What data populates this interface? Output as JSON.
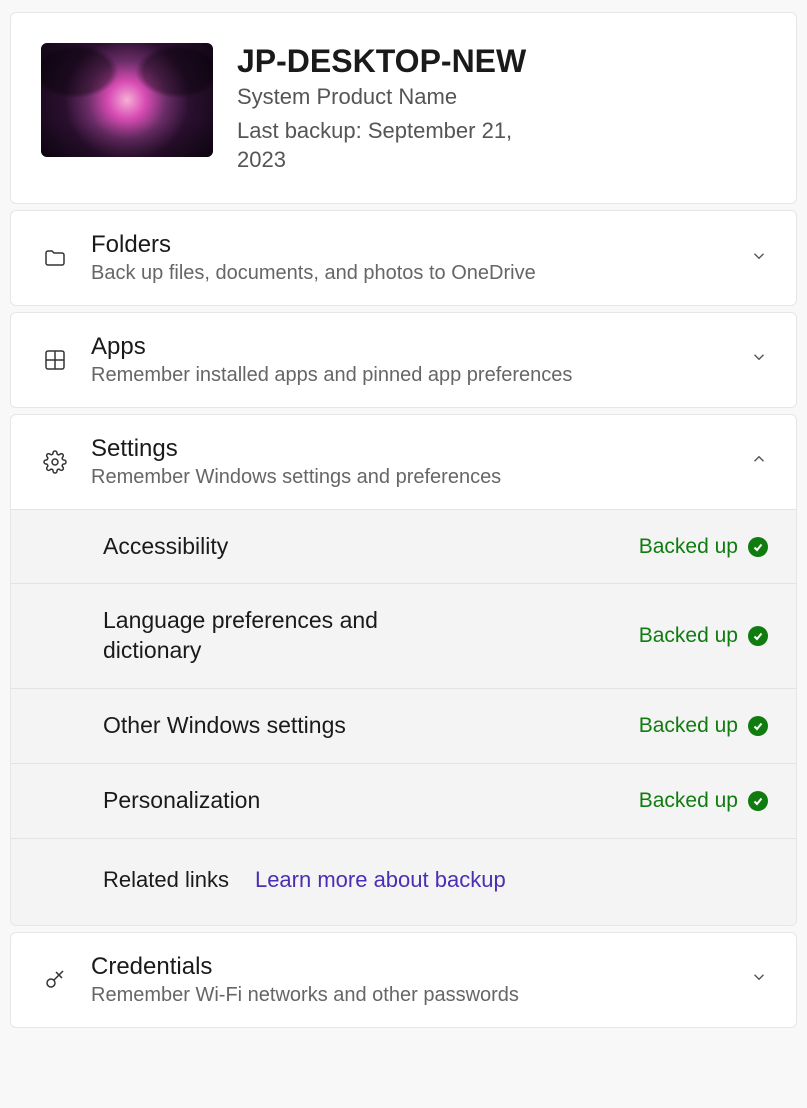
{
  "device": {
    "name": "JP-DESKTOP-NEW",
    "product": "System Product Name",
    "last_backup": "Last backup: September 21, 2023"
  },
  "sections": {
    "folders": {
      "title": "Folders",
      "subtitle": "Back up files, documents, and photos to OneDrive"
    },
    "apps": {
      "title": "Apps",
      "subtitle": "Remember installed apps and pinned app preferences"
    },
    "settings": {
      "title": "Settings",
      "subtitle": "Remember Windows settings and preferences"
    },
    "credentials": {
      "title": "Credentials",
      "subtitle": "Remember Wi-Fi networks and other passwords"
    }
  },
  "settings_items": [
    {
      "name": "Accessibility",
      "status": "Backed up"
    },
    {
      "name": "Language preferences and dictionary",
      "status": "Backed up"
    },
    {
      "name": "Other Windows settings",
      "status": "Backed up"
    },
    {
      "name": "Personalization",
      "status": "Backed up"
    }
  ],
  "related": {
    "label": "Related links",
    "link": "Learn more about backup"
  },
  "colors": {
    "status_green": "#107c10",
    "link_purple": "#4b2fb3"
  }
}
